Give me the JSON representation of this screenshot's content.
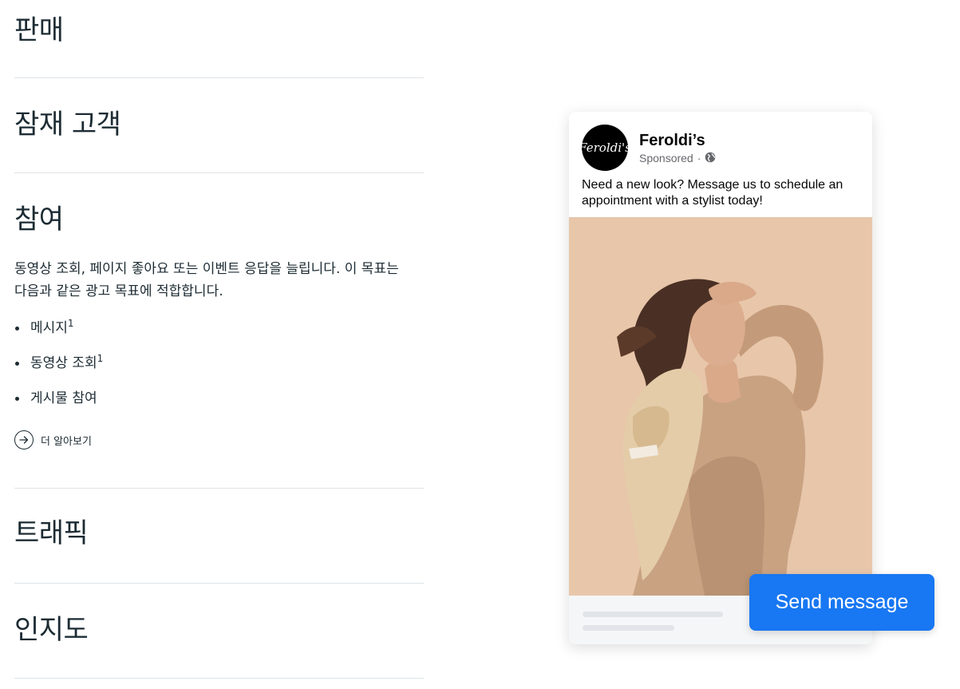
{
  "objectives": {
    "sales": {
      "title": "판매"
    },
    "leads": {
      "title": "잠재 고객"
    },
    "engagement": {
      "title": "참여",
      "description": "동영상 조회, 페이지 좋아요 또는 이벤트 응답을 늘립니다. 이 목표는 다음과 같은 광고 목표에 적합합니다.",
      "list": [
        {
          "label": "메시지",
          "sup": "1"
        },
        {
          "label": "동영상 조회",
          "sup": "1"
        },
        {
          "label": "게시물 참여",
          "sup": ""
        }
      ],
      "learn_more": "더 알아보기"
    },
    "traffic": {
      "title": "트래픽"
    },
    "awareness": {
      "title": "인지도"
    }
  },
  "ad_preview": {
    "logo_text": "Feroldi's",
    "page_name": "Feroldi’s",
    "sponsored": "Sponsored",
    "separator": "·",
    "primary_text": "Need a new look? Message us to schedule an appointment with a stylist today!",
    "cta_label": "Send message"
  },
  "colors": {
    "text": "#1c2b33",
    "divider": "#dfe3e6",
    "cta": "#1877f2",
    "image_background": "#e8c6aa"
  }
}
